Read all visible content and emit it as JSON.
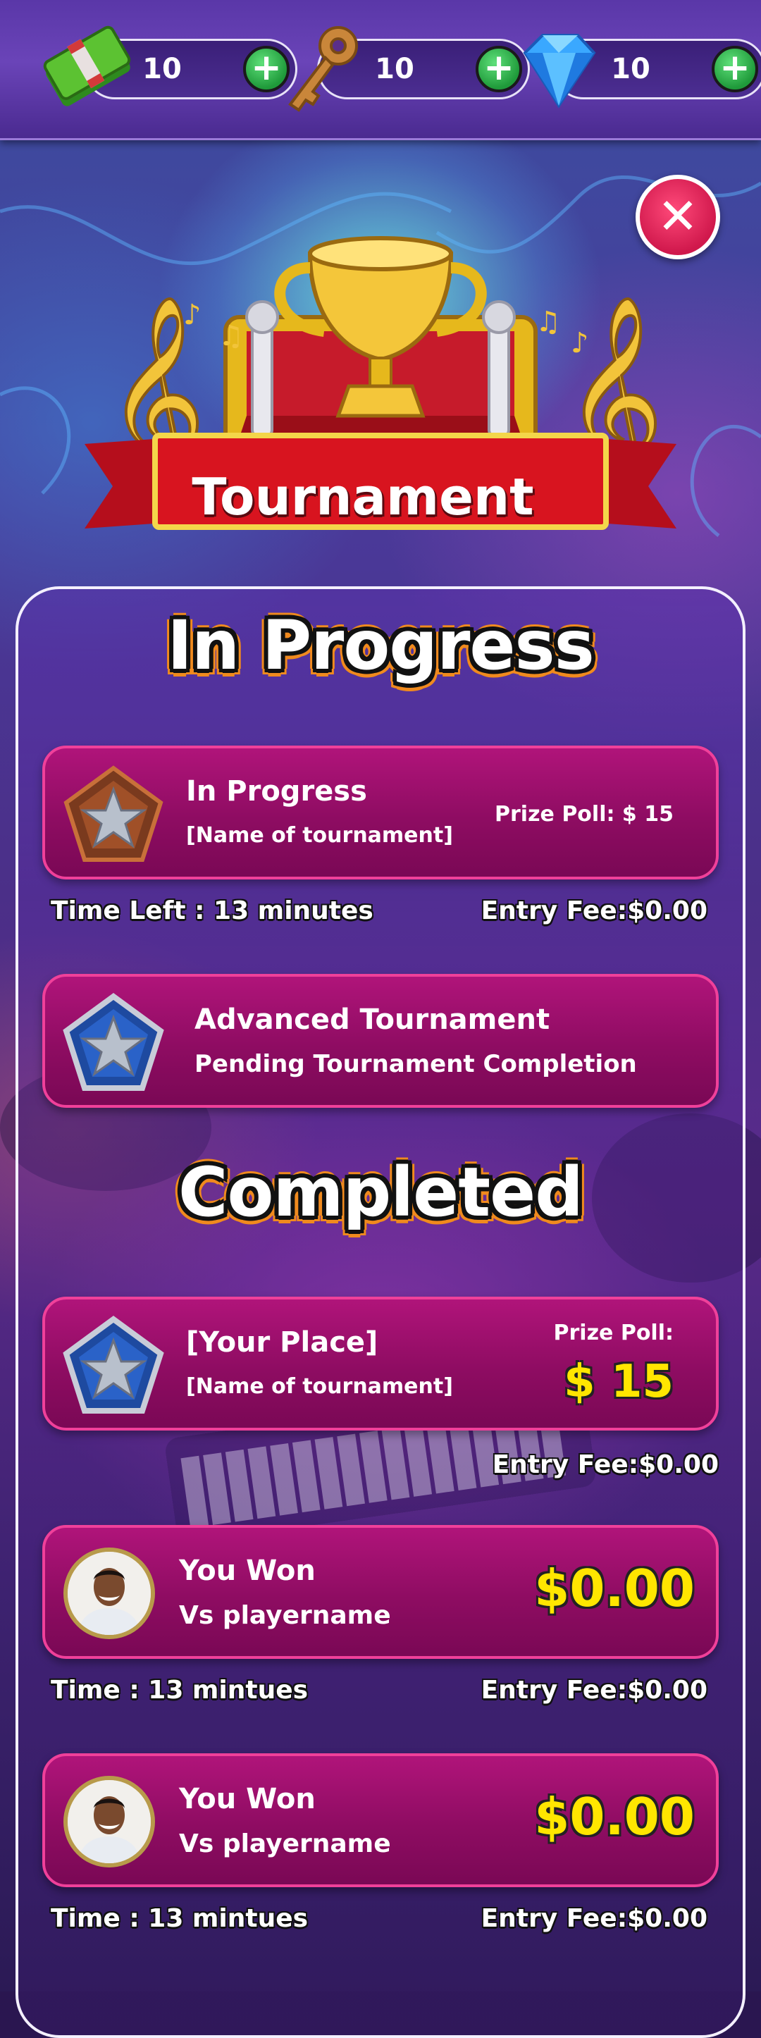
{
  "currencies": [
    {
      "id": "cash",
      "icon": "cash-icon",
      "value": "10"
    },
    {
      "id": "keys",
      "icon": "key-icon",
      "value": "10"
    },
    {
      "id": "gems",
      "icon": "diamond-icon",
      "value": "10"
    }
  ],
  "header": {
    "title": "Tournament"
  },
  "sections": {
    "in_progress": "In Progress",
    "completed": "Completed"
  },
  "in_progress": {
    "card1": {
      "title": "In Progress",
      "subtitle": "[Name of tournament]",
      "prize": "Prize Poll: $ 15",
      "time_left": "Time Left : 13 minutes",
      "entry_fee": "Entry Fee:$0.00"
    },
    "card2": {
      "title": "Advanced Tournament",
      "subtitle": "Pending Tournament Completion"
    }
  },
  "completed": {
    "summary": {
      "title": "[Your Place]",
      "subtitle": "[Name of tournament]",
      "prize_label": "Prize Poll:",
      "prize_value": "$ 15",
      "entry_fee": "Entry Fee:$0.00"
    },
    "matches": [
      {
        "result": "You Won",
        "opponent": "Vs playername",
        "amount": "$0.00",
        "time": "Time : 13 mintues",
        "entry_fee": "Entry Fee:$0.00"
      },
      {
        "result": "You Won",
        "opponent": "Vs playername",
        "amount": "$0.00",
        "time": "Time : 13 mintues",
        "entry_fee": "Entry Fee:$0.00"
      }
    ]
  },
  "colors": {
    "card": "#9a0e6c",
    "card_border": "#f0409a",
    "gold": "#ffe600",
    "close": "#e0245e",
    "plus": "#2fb44a"
  }
}
